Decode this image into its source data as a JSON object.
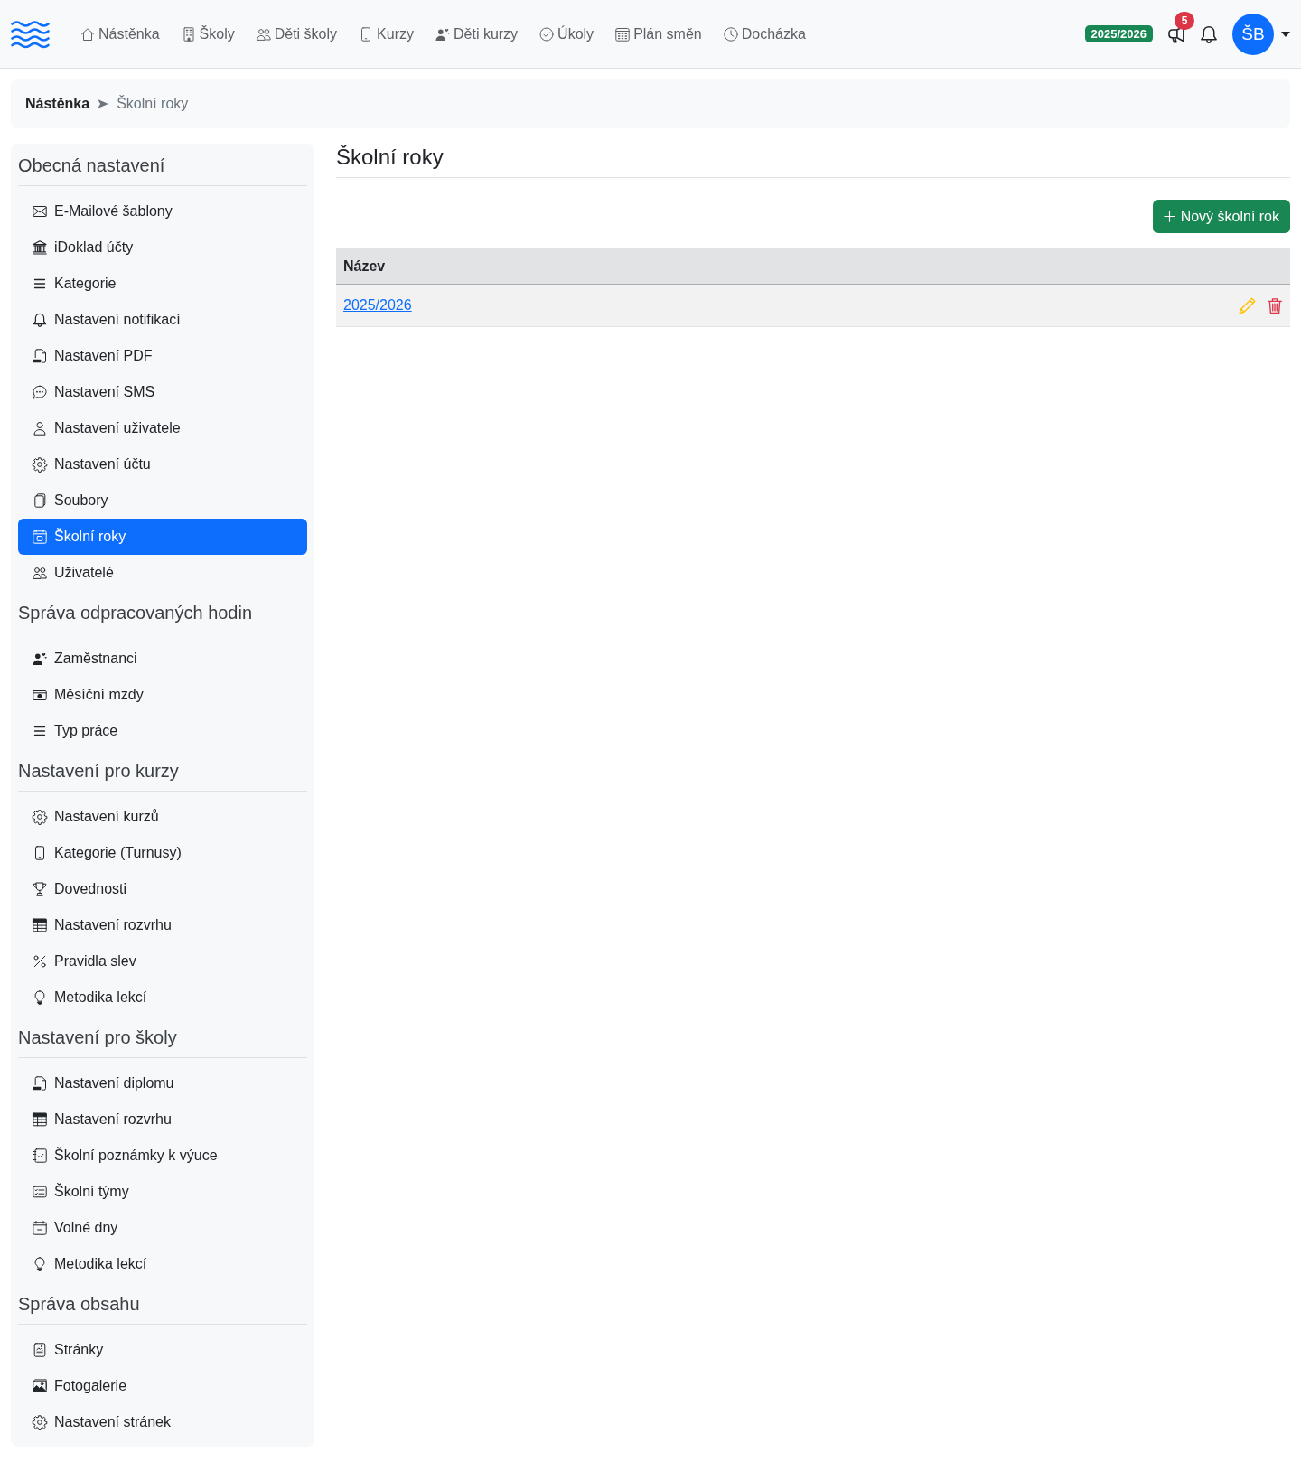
{
  "navbar": {
    "links": [
      "Nástěnka",
      "Školy",
      "Děti školy",
      "Kurzy",
      "Děti kurzy",
      "Úkoly",
      "Plán směn",
      "Docházka"
    ],
    "school_year": "2025/2026",
    "announcement_count": "5",
    "avatar_initials": "ŠB"
  },
  "breadcrumb": {
    "links": [
      "Nástěnka"
    ],
    "current": "Školní roky"
  },
  "sidebar": {
    "sections": [
      {
        "title": "Obecná nastavení",
        "items": [
          {
            "label": "E-Mailové šablony",
            "selected": false
          },
          {
            "label": "iDoklad účty",
            "selected": false
          },
          {
            "label": "Kategorie",
            "selected": false
          },
          {
            "label": "Nastavení notifikací",
            "selected": false
          },
          {
            "label": "Nastavení PDF",
            "selected": false
          },
          {
            "label": "Nastavení SMS",
            "selected": false
          },
          {
            "label": "Nastavení uživatele",
            "selected": false
          },
          {
            "label": "Nastavení účtu",
            "selected": false
          },
          {
            "label": "Soubory",
            "selected": false
          },
          {
            "label": "Školní roky",
            "selected": true
          },
          {
            "label": "Uživatelé",
            "selected": false
          }
        ]
      },
      {
        "title": "Správa odpracovaných hodin",
        "items": [
          {
            "label": "Zaměstnanci",
            "selected": false
          },
          {
            "label": "Měsíční mzdy",
            "selected": false
          },
          {
            "label": "Typ práce",
            "selected": false
          }
        ]
      },
      {
        "title": "Nastavení pro kurzy",
        "items": [
          {
            "label": "Nastavení kurzů",
            "selected": false
          },
          {
            "label": "Kategorie (Turnusy)",
            "selected": false
          },
          {
            "label": "Dovednosti",
            "selected": false
          },
          {
            "label": "Nastavení rozvrhu",
            "selected": false
          },
          {
            "label": "Pravidla slev",
            "selected": false
          },
          {
            "label": "Metodika lekcí",
            "selected": false
          }
        ]
      },
      {
        "title": "Nastavení pro školy",
        "items": [
          {
            "label": "Nastavení diplomu",
            "selected": false
          },
          {
            "label": "Nastavení rozvrhu",
            "selected": false
          },
          {
            "label": "Školní poznámky k výuce",
            "selected": false
          },
          {
            "label": "Školní týmy",
            "selected": false
          },
          {
            "label": "Volné dny",
            "selected": false
          },
          {
            "label": "Metodika lekcí",
            "selected": false
          }
        ]
      },
      {
        "title": "Správa obsahu",
        "items": [
          {
            "label": "Stránky",
            "selected": false
          },
          {
            "label": "Fotogalerie",
            "selected": false
          },
          {
            "label": "Nastavení stránek",
            "selected": false
          }
        ]
      }
    ]
  },
  "page": {
    "title": "Školní roky",
    "new_button": "Nový školní rok",
    "table": {
      "columns": [
        "Název"
      ],
      "rows": [
        {
          "cells": [
            "2025/2026"
          ]
        }
      ]
    }
  }
}
